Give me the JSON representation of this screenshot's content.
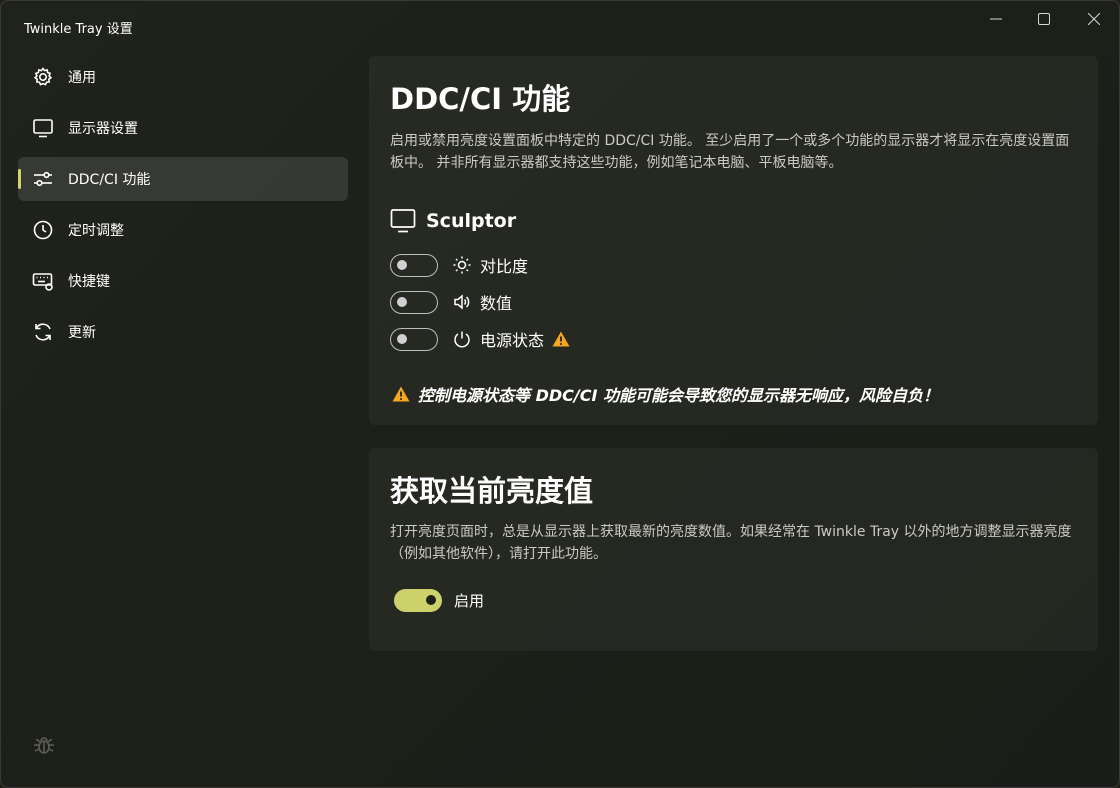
{
  "window": {
    "title": "Twinkle Tray 设置"
  },
  "sidebar": {
    "items": [
      {
        "label": "通用",
        "icon": "gear-icon"
      },
      {
        "label": "显示器设置",
        "icon": "monitor-icon"
      },
      {
        "label": "DDC/CI 功能",
        "icon": "sliders-icon",
        "active": true
      },
      {
        "label": "定时调整",
        "icon": "clock-icon"
      },
      {
        "label": "快捷键",
        "icon": "keyboard-icon"
      },
      {
        "label": "更新",
        "icon": "refresh-icon"
      }
    ],
    "footer_icon": "bug-icon"
  },
  "ddc": {
    "title": "DDC/CI 功能",
    "description": "启用或禁用亮度设置面板中特定的 DDC/CI 功能。 至少启用了一个或多个功能的显示器才将显示在亮度设置面板中。 并非所有显示器都支持这些功能，例如笔记本电脑、平板电脑等。",
    "monitor_name": "Sculptor",
    "features": [
      {
        "label": "对比度",
        "icon": "sun-icon",
        "enabled": false
      },
      {
        "label": "数值",
        "icon": "volume-icon",
        "enabled": false
      },
      {
        "label": "电源状态",
        "icon": "power-icon",
        "enabled": false,
        "warning": true
      }
    ],
    "warning_text": "控制电源状态等 DDC/CI 功能可能会导致您的显示器无响应，风险自负！"
  },
  "brightness": {
    "title": "获取当前亮度值",
    "description": "打开亮度页面时，总是从显示器上获取最新的亮度数值。如果经常在 Twinkle Tray 以外的地方调整显示器亮度（例如其他软件），请打开此功能。",
    "toggle_label": "启用",
    "enabled": true
  },
  "colors": {
    "accent": "#cdd16c",
    "warning": "#f5a623"
  }
}
